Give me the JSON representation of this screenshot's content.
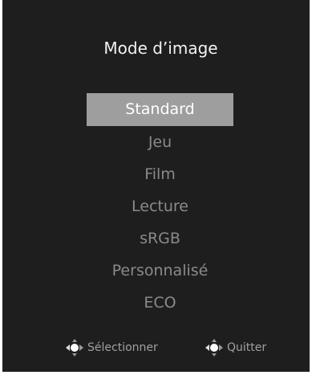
{
  "osd": {
    "title": "Mode d’image",
    "items": [
      {
        "label": "Standard",
        "selected": true
      },
      {
        "label": "Jeu",
        "selected": false
      },
      {
        "label": "Film",
        "selected": false
      },
      {
        "label": "Lecture",
        "selected": false
      },
      {
        "label": "sRGB",
        "selected": false
      },
      {
        "label": "Personnalisé",
        "selected": false
      },
      {
        "label": "ECO",
        "selected": false
      }
    ],
    "footer": {
      "select_label": "Sélectionner",
      "select_icon": "joystick-select-icon",
      "quit_label": "Quitter",
      "quit_icon": "joystick-quit-icon"
    },
    "colors": {
      "background": "#1e1e1e",
      "highlight": "#9e9e9e",
      "scroll_indicator": "#1f7fd1"
    }
  }
}
